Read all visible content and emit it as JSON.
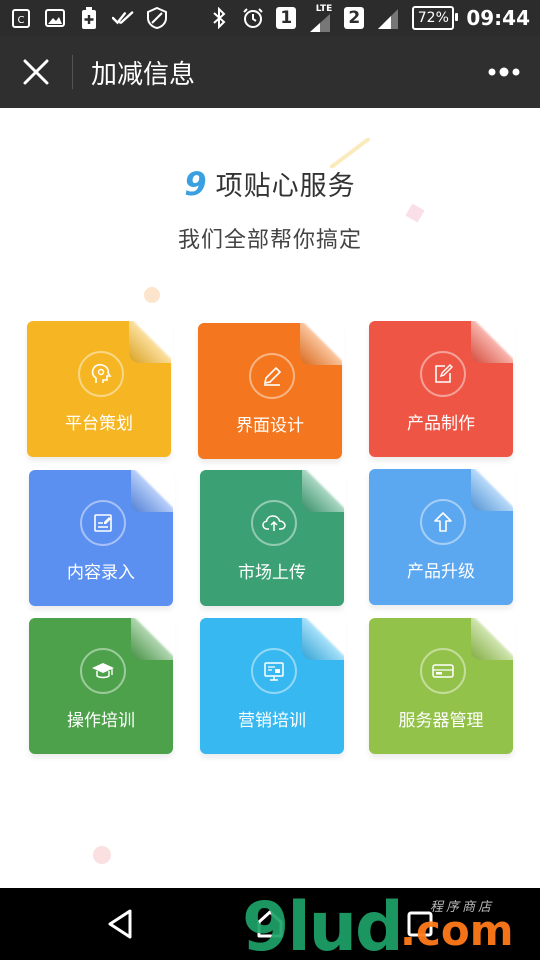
{
  "status_bar": {
    "sim1": "1",
    "network_type": "LTE",
    "sim2": "2",
    "battery": "72%",
    "time": "09:44"
  },
  "title_bar": {
    "title": "加减信息",
    "close_icon": "close-icon",
    "more_icon": "more-dots-icon"
  },
  "header": {
    "number": "9",
    "title": "项贴心服务",
    "subtitle": "我们全部帮你搞定"
  },
  "services": [
    {
      "label": "平台策划",
      "icon": "lightbulb-head-icon",
      "color": "#f6b623"
    },
    {
      "label": "界面设计",
      "icon": "pencil-icon",
      "color": "#f4771f"
    },
    {
      "label": "产品制作",
      "icon": "edit-icon",
      "color": "#ef5544"
    },
    {
      "label": "内容录入",
      "icon": "input-form-icon",
      "color": "#5b8ff0"
    },
    {
      "label": "市场上传",
      "icon": "cloud-upload-icon",
      "color": "#3ba174"
    },
    {
      "label": "产品升级",
      "icon": "arrow-up-icon",
      "color": "#5ba7f0"
    },
    {
      "label": "操作培训",
      "icon": "graduation-cap-icon",
      "color": "#4ca14a"
    },
    {
      "label": "营销培训",
      "icon": "presentation-icon",
      "color": "#37b8f0"
    },
    {
      "label": "服务器管理",
      "icon": "server-icon",
      "color": "#93c24a"
    }
  ],
  "nav_bar": {
    "back_icon": "back-icon",
    "home_icon": "home-icon",
    "recents_icon": "recents-icon"
  },
  "watermark": {
    "main": "9lud",
    "dot": ".com",
    "tagline": "程序商店"
  }
}
